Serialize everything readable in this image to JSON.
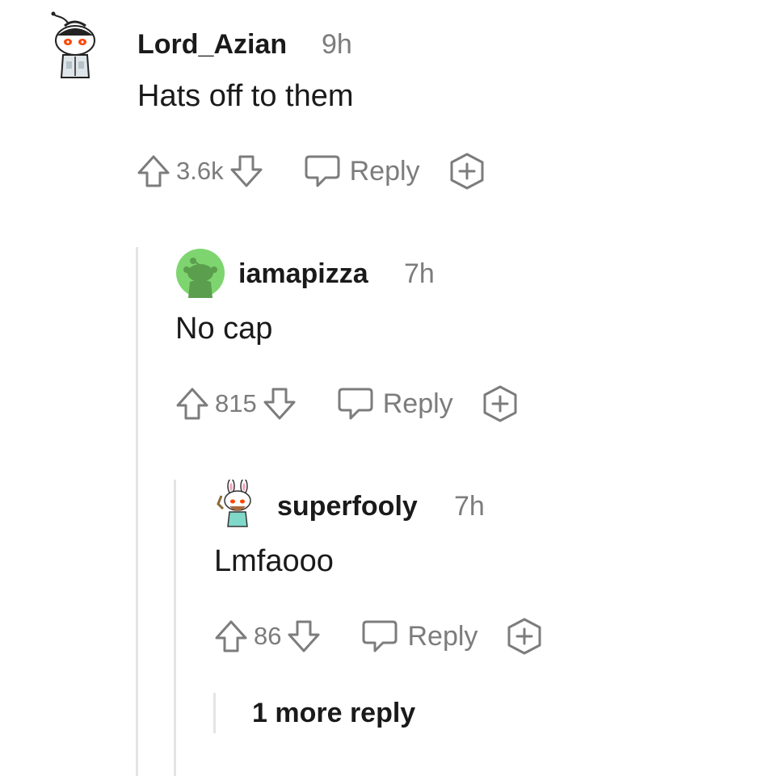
{
  "comments": [
    {
      "username": "Lord_Azian",
      "age": "9h",
      "body": "Hats off to them",
      "score": "3.6k",
      "reply_label": "Reply"
    },
    {
      "username": "iamapizza",
      "age": "7h",
      "body": "No cap",
      "score": "815",
      "reply_label": "Reply"
    },
    {
      "username": "superfooly",
      "age": "7h",
      "body": "Lmfaooo",
      "score": "86",
      "reply_label": "Reply"
    }
  ],
  "more_replies": "1 more reply",
  "colors": {
    "meta_gray": "#7c7c7c",
    "text": "#1a1a1b",
    "thread_line": "#e4e4e4",
    "avatar_green": "#7ed56f",
    "avatar_green_dark": "#5b9e4d",
    "snoo_red": "#ff4500"
  },
  "icons": [
    "snoo-avatar-icon",
    "upvote-icon",
    "downvote-icon",
    "comment-bubble-icon",
    "award-icon"
  ]
}
